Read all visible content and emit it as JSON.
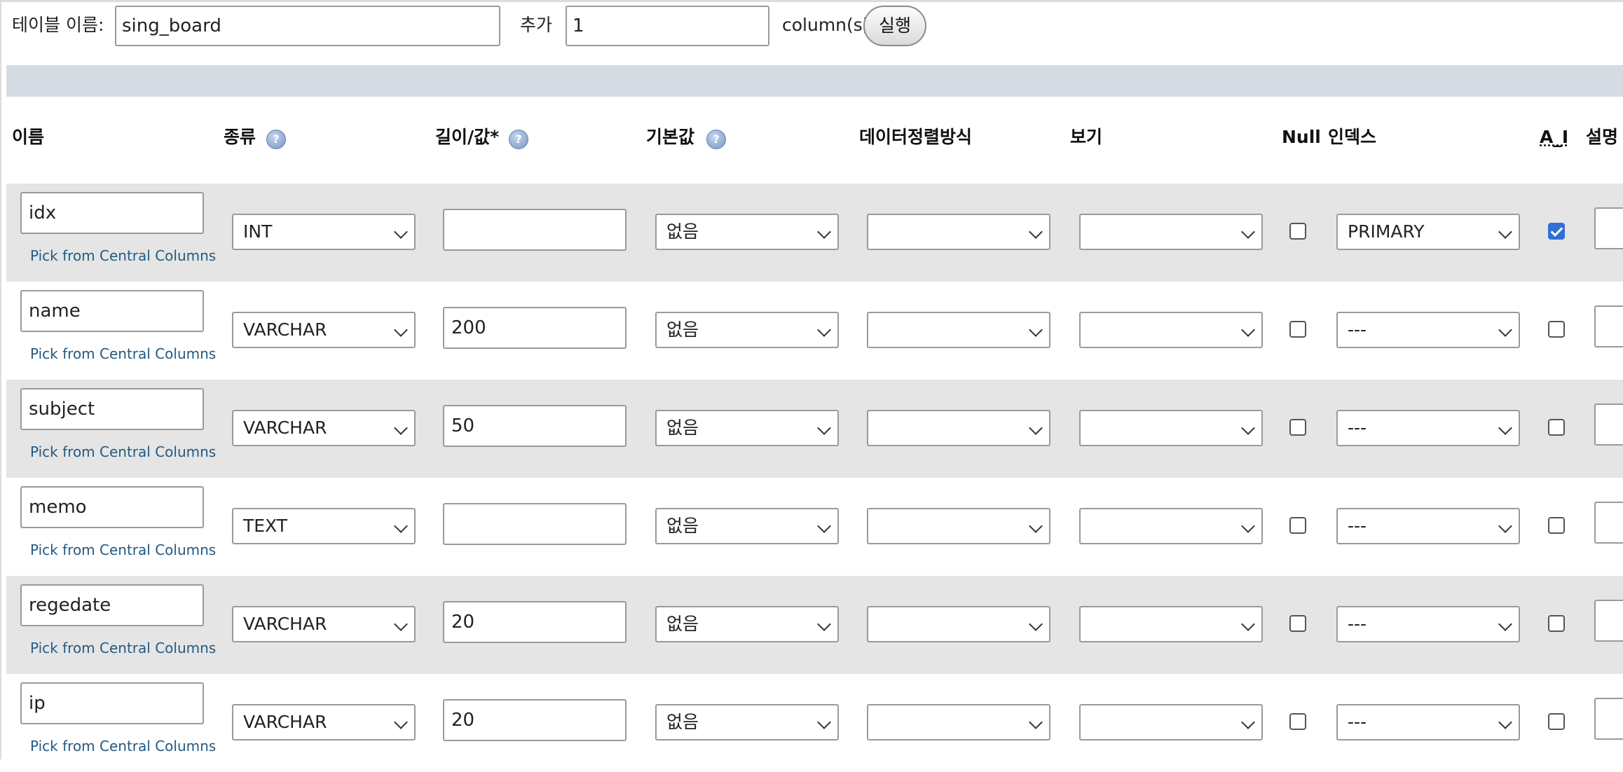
{
  "toolbar": {
    "table_name_label": "테이블 이름:",
    "table_name_value": "sing_board",
    "add_label": "추가",
    "add_count_value": "1",
    "columns_label": "column(s)",
    "go_button": "실행"
  },
  "headers": {
    "name": "이름",
    "type": "종류",
    "length": "길이/값*",
    "default": "기본값",
    "collation": "데이터정렬방식",
    "attributes": "보기",
    "null": "Null",
    "index": "인덱스",
    "ai": "A_I",
    "comment": "설명"
  },
  "pick_link": "Pick from Central Columns",
  "rows": [
    {
      "name": "idx",
      "type": "INT",
      "length": "",
      "default": "없음",
      "collation": "",
      "attributes": "",
      "null": false,
      "index": "PRIMARY",
      "ai": true
    },
    {
      "name": "name",
      "type": "VARCHAR",
      "length": "200",
      "default": "없음",
      "collation": "",
      "attributes": "",
      "null": false,
      "index": "---",
      "ai": false
    },
    {
      "name": "subject",
      "type": "VARCHAR",
      "length": "50",
      "default": "없음",
      "collation": "",
      "attributes": "",
      "null": false,
      "index": "---",
      "ai": false
    },
    {
      "name": "memo",
      "type": "TEXT",
      "length": "",
      "default": "없음",
      "collation": "",
      "attributes": "",
      "null": false,
      "index": "---",
      "ai": false
    },
    {
      "name": "regedate",
      "type": "VARCHAR",
      "length": "20",
      "default": "없음",
      "collation": "",
      "attributes": "",
      "null": false,
      "index": "---",
      "ai": false
    },
    {
      "name": "ip",
      "type": "VARCHAR",
      "length": "20",
      "default": "없음",
      "collation": "",
      "attributes": "",
      "null": false,
      "index": "---",
      "ai": false
    }
  ]
}
